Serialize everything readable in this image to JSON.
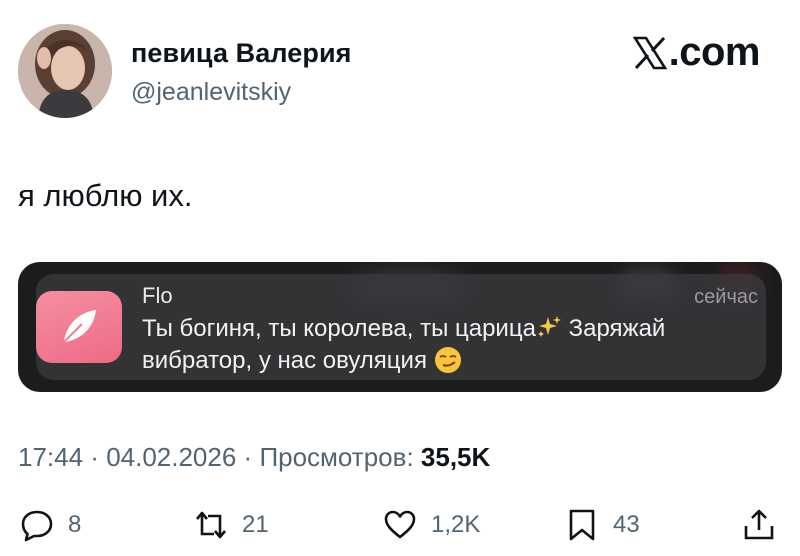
{
  "author": {
    "name": "певица Валерия",
    "handle": "@jeanlevitskiy"
  },
  "brand": {
    "label": ".com",
    "icon": "x-logo-icon"
  },
  "tweet": {
    "text": "я люблю их."
  },
  "notification": {
    "app": "Flo",
    "time": "сейчас",
    "body_part1": "Ты богиня, ты королева, ты царица",
    "body_part2": " Заряжай вибратор, у нас овуляция",
    "icons": [
      "flo-feather-icon",
      "sparkles-emoji",
      "smirk-emoji"
    ],
    "accent": "#ef6a86"
  },
  "meta": {
    "time": "17:44",
    "separator1": " · ",
    "date": "04.02.2026",
    "separator2": " · ",
    "views_label": "Просмотров: ",
    "views_value": "35,5K"
  },
  "actions": {
    "replies": "8",
    "reposts": "21",
    "likes": "1,2K",
    "bookmarks": "43"
  }
}
